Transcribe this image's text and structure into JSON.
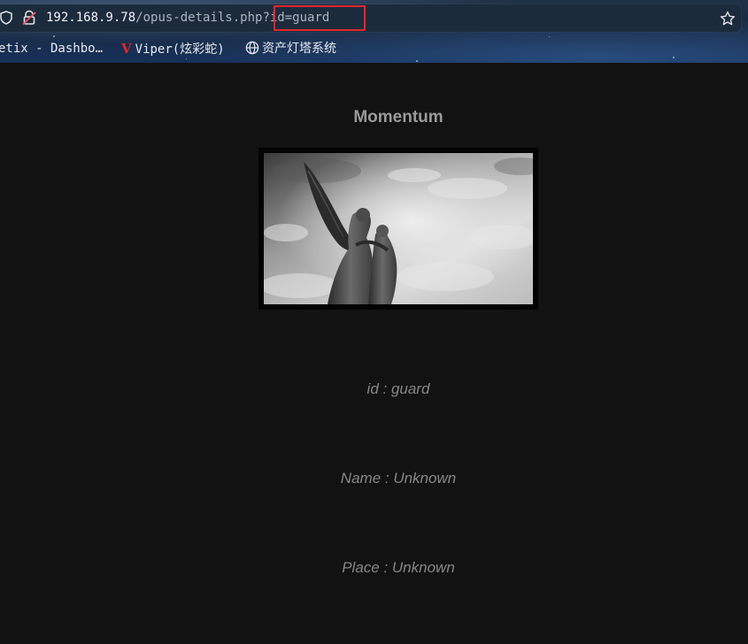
{
  "browser": {
    "url_host": "192.168.9.78",
    "url_path": "/opus-details.php",
    "url_query": "?id=guard",
    "bookmarks": [
      {
        "label": "etix - Dashbo…",
        "icon": "none"
      },
      {
        "label": "Viper(炫彩蛇)",
        "icon": "viper-logo-icon"
      },
      {
        "label": "资产灯塔系统",
        "icon": "globe-icon"
      }
    ],
    "colors": {
      "highlight_box": "#e0282e",
      "viper_logo": "#e3262c"
    }
  },
  "page": {
    "title": "Momentum",
    "image_subject": "black-and-white photograph of an angel statue embracing a figure against a cloudy sky",
    "details": {
      "id_text": "id : guard",
      "name_text": "Name : Unknown",
      "place_text": "Place : Unknown"
    },
    "colors": {
      "background": "#121212",
      "title": "#9a9a9a",
      "detail_text": "#868686"
    }
  }
}
